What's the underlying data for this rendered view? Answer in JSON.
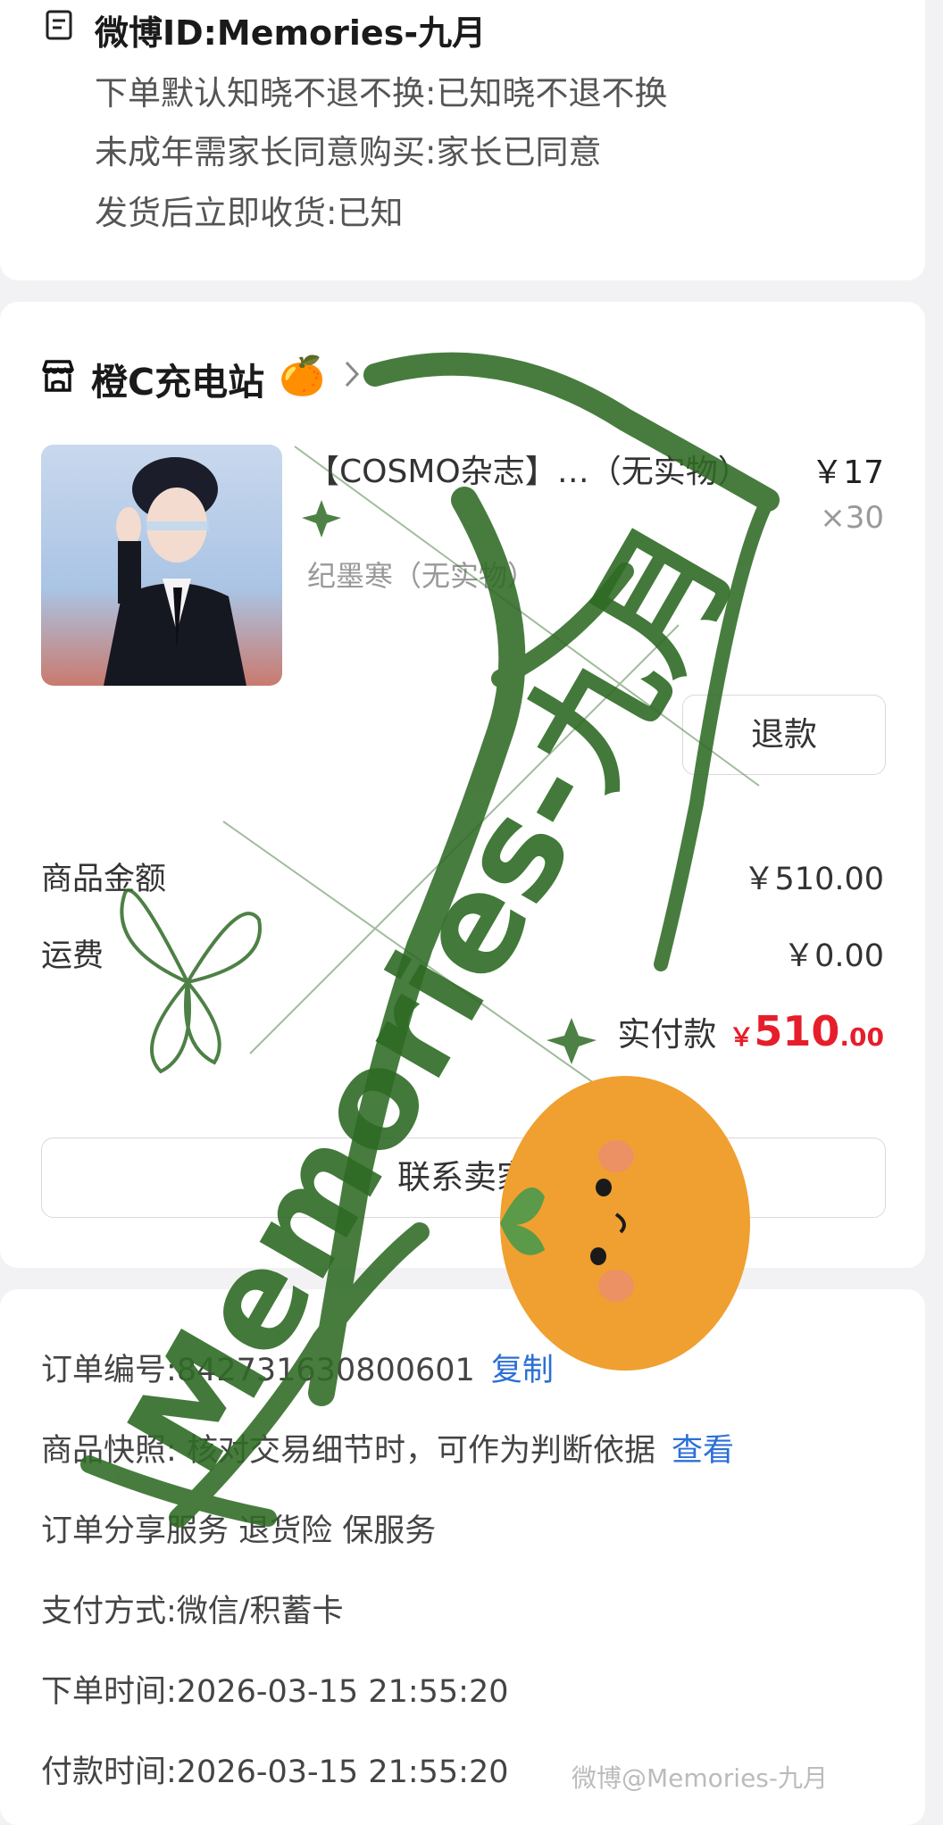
{
  "notes": {
    "title": "微博ID:Memories-九月",
    "lines": [
      "下单默认知晓不退不换:已知晓不退不换",
      "未成年需家长同意购买:家长已同意",
      "发货后立即收货:已知"
    ]
  },
  "shop": {
    "name": "橙C充电站",
    "emoji": "🍊",
    "product": {
      "title": "【COSMO杂志】…（无实物）",
      "spec": "纪墨寒（无实物）",
      "price": "￥17",
      "qty": "×30"
    },
    "refund_label": "退款",
    "summary": {
      "goods_label": "商品金额",
      "goods_value": "￥510.00",
      "shipping_label": "运费",
      "shipping_value": "￥0.00",
      "paid_label": "实付款",
      "paid_symbol": "￥",
      "paid_int": "510",
      "paid_dec": ".00"
    },
    "contact_label": "联系卖家"
  },
  "order": {
    "number_label": "订单编号:",
    "number_value": "842731630800601",
    "copy_label": "复制",
    "snapshot_label": "商品快照:",
    "snapshot_text": "核对交易细节时，可作为判断依据",
    "snapshot_link": "查看",
    "service_text": "订单分享服务 退货险 保服务",
    "payment_text": "支付方式:微信/积蓄卡",
    "order_time": "下单时间:2026-03-15 21:55:20",
    "pay_time": "付款时间:2026-03-15 21:55:20"
  },
  "watermark": {
    "text": "Memories-九月",
    "credit": "微博@Memories-九月"
  },
  "colors": {
    "accent_red": "#e61e2b",
    "link_blue": "#2b6fd6",
    "watermark_green": "#2f6b25",
    "orange": "#f0a030"
  }
}
